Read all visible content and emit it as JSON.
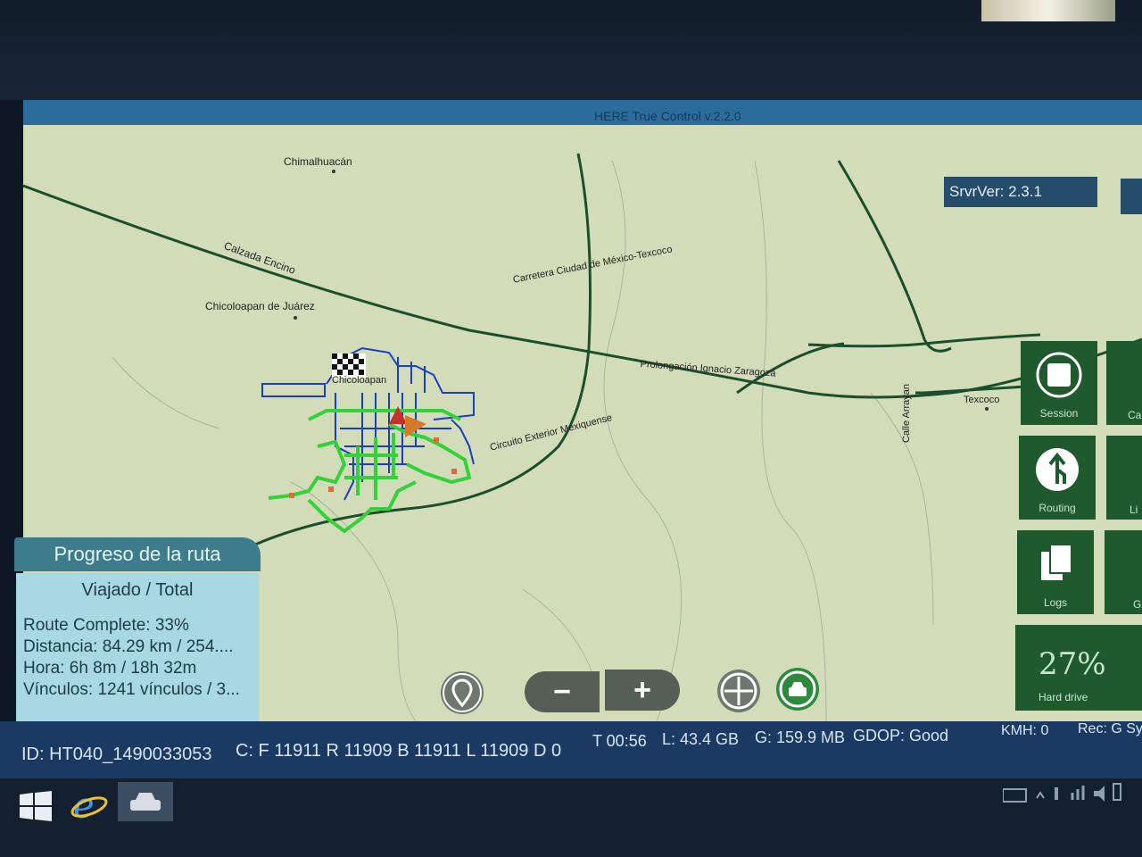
{
  "app": {
    "title": "HERE True Control v.2.2.0",
    "server_version": "SrvrVer: 2.3.1"
  },
  "map_labels": {
    "chimalhuacan": "Chimalhuacán",
    "calzada": "Calzada Encino",
    "chicoloapan": "Chicoloapan de Juárez",
    "carretera": "Carretera Ciudad de México-Texcoco",
    "prolongacion": "Prolongación Ignacio Zaragoza",
    "circuito": "Circuito Exterior Mexiquense",
    "arrayan": "Calle Arrayan",
    "texcoco": "Texcoco",
    "chicoloapan_short": "Chicoloapan"
  },
  "progress_panel": {
    "title": "Progreso de la ruta",
    "subtitle": "Viajado / Total",
    "route_complete_label": "Route Complete:",
    "route_complete_value": "33%",
    "distance_label": "Distancia:",
    "distance_value": "84.29 km / 254....",
    "time_label": "Hora:",
    "time_value": "6h 8m / 18h 32m",
    "links_label": "Vínculos:",
    "links_value": "1241 vínculos / 3..."
  },
  "side_buttons": {
    "session": "Session",
    "routing": "Routing",
    "logs": "Logs",
    "camera_partial": "Ca",
    "lidar_partial": "Li",
    "gps_partial": "G"
  },
  "hard_drive": {
    "percent": "27%",
    "label": "Hard drive"
  },
  "zoom": {
    "minus": "−",
    "plus": "+"
  },
  "status_bar": {
    "id": "ID: HT040_1490033053",
    "counts": "C: F 11911 R 11909 B 11911 L 11909 D 0",
    "time": "T 00:56",
    "local": "L:  43.4 GB",
    "gps_storage": "G: 159.9 MB",
    "gdop": "GDOP: Good",
    "kmh": "KMH: 0",
    "rec": "Rec: G  Sy"
  },
  "icons": {
    "windows": "windows-logo-icon",
    "ie": "internet-explorer-icon",
    "car": "car-app-icon"
  },
  "colors": {
    "route_blue": "#1b3fc4",
    "route_green": "#34d23a",
    "road": "#1b4f2c",
    "tile": "#1e5a2e"
  }
}
